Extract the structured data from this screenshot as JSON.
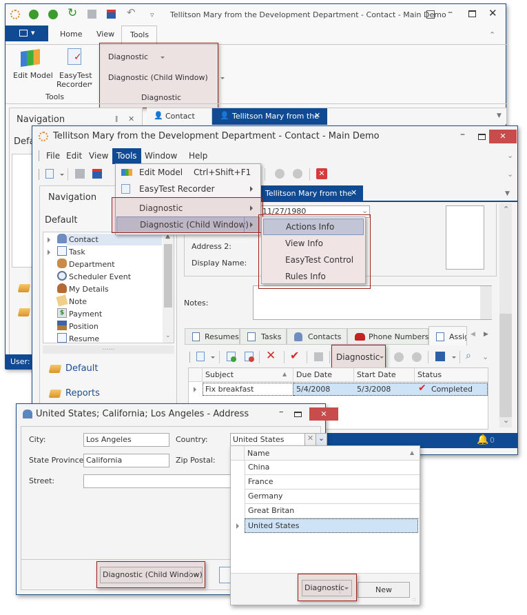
{
  "back_window": {
    "title": "Tellitson Mary from the Development Department - Contact - Main Demo",
    "ribbon_tabs": [
      "Home",
      "View",
      "Tools"
    ],
    "active_tab": "Tools",
    "tools_group": {
      "label": "Tools",
      "edit_model": "Edit Model",
      "easytest_line1": "EasyTest",
      "easytest_line2": "Recorder"
    },
    "diagnostic_group": {
      "label": "Diagnostic",
      "item1": "Diagnostic",
      "item2": "Diagnostic (Child Window)"
    },
    "nav_title": "Navigation",
    "nav_default": "Defa",
    "doc_tabs": [
      "Contact",
      "Tellitson Mary from the"
    ],
    "status_user": "User: S"
  },
  "main_window": {
    "title": "Tellitson Mary from the Development Department - Contact - Main Demo",
    "menu": [
      "File",
      "Edit",
      "View",
      "Tools",
      "Window",
      "Help"
    ],
    "active_menu": "Tools",
    "tools_menu": [
      {
        "label": "Edit Model",
        "shortcut": "Ctrl+Shift+F1",
        "icon": "edit-model-icon"
      },
      {
        "label": "EasyTest Recorder",
        "submenu": true,
        "icon": "easytest-recorder-icon"
      },
      {
        "label": "Diagnostic",
        "submenu": true
      },
      {
        "label": "Diagnostic (Child Window)",
        "submenu": true,
        "selected": true
      }
    ],
    "submenu": [
      "Actions Info",
      "View Info",
      "EasyTest Control",
      "Rules Info"
    ],
    "submenu_selected": "Actions Info",
    "nav_title": "Navigation",
    "nav_group": "Default",
    "nav_items": [
      "Contact",
      "Task",
      "Department",
      "Scheduler Event",
      "My Details",
      "Note",
      "Payment",
      "Position",
      "Resume"
    ],
    "nav_selected": "Contact",
    "nav_groups_bottom": [
      "Default",
      "Reports"
    ],
    "doc_tab": "Tellitson Mary from the",
    "form": {
      "birthday": "11/27/1980",
      "address2_label": "Address 2:",
      "display_name_label": "Display Name:",
      "notes_label": "Notes:"
    },
    "detail_tabs": [
      "Resumes",
      "Tasks",
      "Contacts",
      "Phone Numbers",
      "Assig"
    ],
    "active_detail_tab": "Assig",
    "diagnostic_button": "Diagnostic",
    "grid": {
      "columns": [
        "Subject",
        "Due Date",
        "Start Date",
        "Status"
      ],
      "rows": [
        {
          "subject": "Fix breakfast",
          "due": "5/4/2008",
          "start": "5/3/2008",
          "status": "Completed"
        }
      ]
    },
    "notifications_count": "0"
  },
  "address_window": {
    "title": "United States; California; Los Angeles - Address",
    "city_label": "City:",
    "city": "Los Angeles",
    "country_label": "Country:",
    "country": "United States",
    "state_label": "State Province:",
    "state": "California",
    "zip_label": "Zip Postal:",
    "street_label": "Street:",
    "street": "",
    "diagnostic_button": "Diagnostic (Child Window)"
  },
  "country_lookup": {
    "column": "Name",
    "items": [
      "China",
      "France",
      "Germany",
      "Great Britan",
      "United States"
    ],
    "selected": "United States",
    "diagnostic_button": "Diagnostic",
    "new_button": "New"
  }
}
